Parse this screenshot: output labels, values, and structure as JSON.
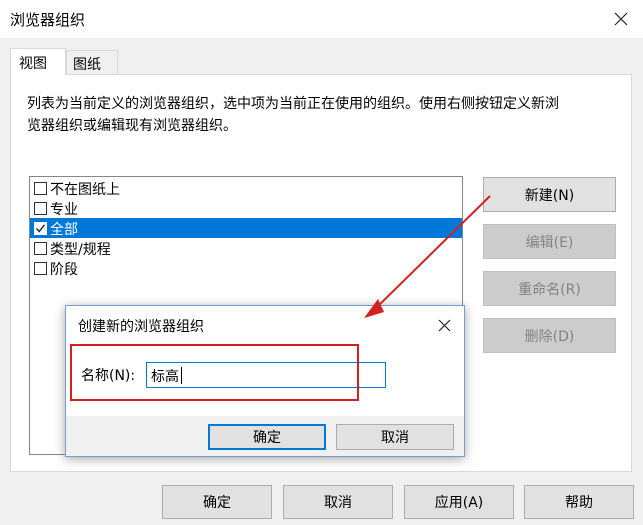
{
  "window": {
    "title": "浏览器组织"
  },
  "tabs": [
    {
      "label": "视图",
      "active": true
    },
    {
      "label": "图纸",
      "active": false
    }
  ],
  "description": {
    "line1": "列表为当前定义的浏览器组织，选中项为当前正在使用的组织。使用右侧按钮定义新浏",
    "line2": "览器组织或编辑现有浏览器组织。"
  },
  "list": {
    "items": [
      {
        "label": "不在图纸上",
        "checked": false,
        "selected": false
      },
      {
        "label": "专业",
        "checked": false,
        "selected": false
      },
      {
        "label": "全部",
        "checked": true,
        "selected": true
      },
      {
        "label": "类型/规程",
        "checked": false,
        "selected": false
      },
      {
        "label": "阶段",
        "checked": false,
        "selected": false
      }
    ]
  },
  "side_buttons": {
    "new": "新建(N)",
    "edit": "编辑(E)",
    "rename": "重命名(R)",
    "delete": "删除(D)"
  },
  "bottom_buttons": {
    "ok": "确定",
    "cancel": "取消",
    "apply": "应用(A)",
    "help": "帮助"
  },
  "dialog": {
    "title": "创建新的浏览器组织",
    "name_label": "名称(N):",
    "name_value": "标高",
    "ok": "确定",
    "cancel": "取消"
  },
  "colors": {
    "accent": "#0078d7",
    "annotation_red": "#d42020"
  }
}
